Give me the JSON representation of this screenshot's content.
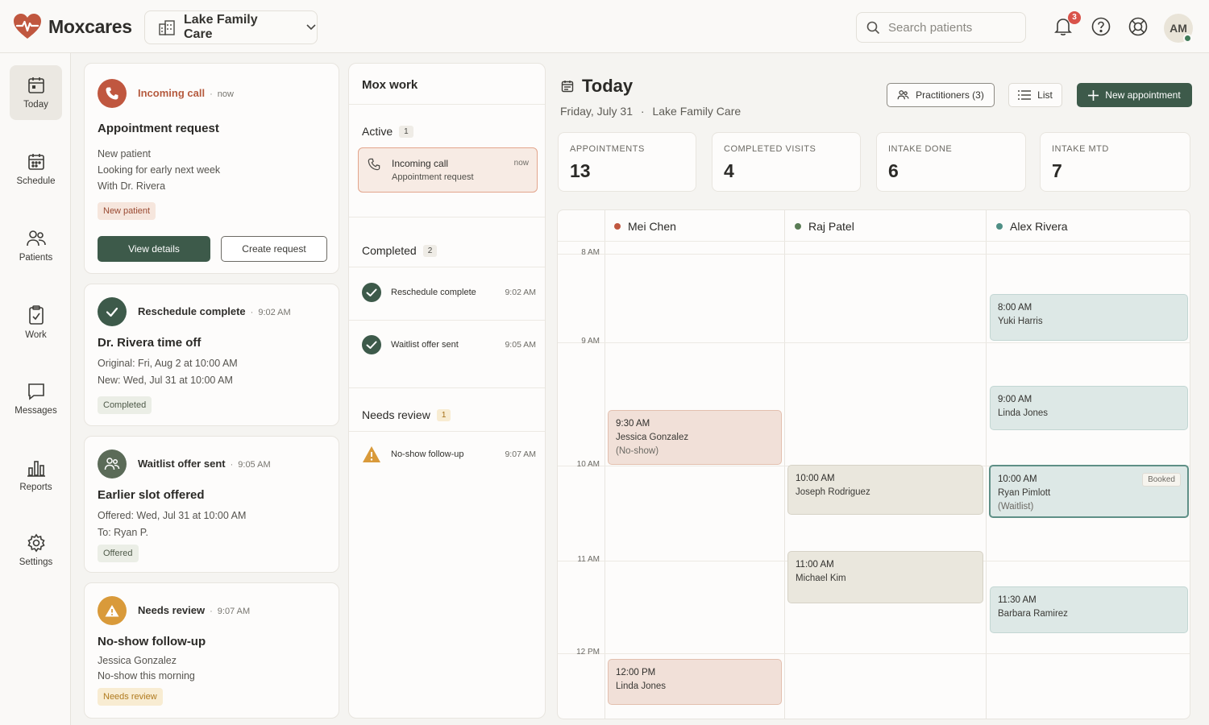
{
  "brand": {
    "name": "Moxcares",
    "color": "#c0573f"
  },
  "clinic": {
    "name": "Lake Family Care"
  },
  "search": {
    "placeholder": "Search patients"
  },
  "notifications": {
    "count": "3"
  },
  "user": {
    "initials": "AM",
    "status": "online"
  },
  "sidebar": {
    "items": [
      {
        "label": "Today",
        "icon": "calendar-today-icon",
        "active": true
      },
      {
        "label": "Schedule",
        "icon": "calendar-grid-icon"
      },
      {
        "label": "Patients",
        "icon": "users-icon"
      },
      {
        "label": "Work",
        "icon": "clipboard-check-icon"
      },
      {
        "label": "Messages",
        "icon": "message-icon"
      },
      {
        "label": "Reports",
        "icon": "bar-chart-icon"
      },
      {
        "label": "Settings",
        "icon": "gear-icon"
      }
    ]
  },
  "cards": {
    "incoming": {
      "head": "Incoming call",
      "time": "now",
      "title": "Appointment request",
      "lines": [
        "New patient",
        "Looking for early next week",
        "With Dr. Rivera"
      ],
      "pill": "New patient",
      "primary": "View details",
      "secondary": "Create request"
    },
    "reschedule": {
      "head": "Reschedule complete",
      "time": "9:02 AM",
      "title": "Dr. Rivera time off",
      "lines": [
        "Original: Fri, Aug 2 at 10:00 AM",
        "New: Wed, Jul 31 at 10:00 AM"
      ],
      "pill": "Completed"
    },
    "waitlist": {
      "head": "Waitlist offer sent",
      "time": "9:05 AM",
      "title": "Earlier slot offered",
      "lines": [
        "Offered: Wed, Jul 31 at 10:00 AM",
        "To: Ryan P."
      ],
      "pill": "Offered"
    },
    "review": {
      "head": "Needs review",
      "time": "9:07 AM",
      "title": "No-show follow-up",
      "lines": [
        "Jessica Gonzalez",
        "No-show this morning"
      ],
      "pill": "Needs review"
    }
  },
  "mox": {
    "title": "Mox work",
    "active": {
      "label": "Active",
      "count": "1",
      "item": {
        "title": "Incoming call",
        "subtitle": "Appointment request",
        "time": "now"
      }
    },
    "completed": {
      "label": "Completed",
      "count": "2",
      "items": [
        {
          "label": "Reschedule complete",
          "time": "9:02 AM"
        },
        {
          "label": "Waitlist offer sent",
          "time": "9:05 AM"
        }
      ]
    },
    "review": {
      "label": "Needs review",
      "count": "1",
      "items": [
        {
          "label": "No-show follow-up",
          "time": "9:07 AM"
        }
      ]
    }
  },
  "today": {
    "title": "Today",
    "date": "Friday, July 31",
    "location": "Lake Family Care",
    "practitioners_btn": "Practitioners (3)",
    "list_btn": "List",
    "new_btn": "New appointment"
  },
  "stats": [
    {
      "label": "APPOINTMENTS",
      "value": "13"
    },
    {
      "label": "COMPLETED VISITS",
      "value": "4"
    },
    {
      "label": "INTAKE DONE",
      "value": "6"
    },
    {
      "label": "INTAKE MTD",
      "value": "7"
    }
  ],
  "calendar": {
    "hours": [
      "8 AM",
      "9 AM",
      "10 AM",
      "11 AM",
      "12 PM"
    ],
    "practitioners": [
      {
        "name": "Mei Chen",
        "color": "#c0573f"
      },
      {
        "name": "Raj Patel",
        "color": "#5a7c55"
      },
      {
        "name": "Alex Rivera",
        "color": "#4f8f85"
      }
    ],
    "appointments": {
      "jessica": {
        "time": "9:30 AM",
        "name": "Jessica Gonzalez",
        "note": "(No-show)"
      },
      "linda_mei": {
        "time": "12:00 PM",
        "name": "Linda Jones"
      },
      "joseph": {
        "time": "10:00 AM",
        "name": "Joseph Rodriguez"
      },
      "michael": {
        "time": "11:00 AM",
        "name": "Michael Kim"
      },
      "yuki": {
        "time": "8:00 AM",
        "name": "Yuki Harris"
      },
      "linda_alex": {
        "time": "9:00 AM",
        "name": "Linda Jones"
      },
      "ryan": {
        "time": "10:00 AM",
        "name": "Ryan Pimlott",
        "note": "(Waitlist)",
        "badge": "Booked"
      },
      "barbara": {
        "time": "11:30 AM",
        "name": "Barbara Ramirez"
      }
    }
  }
}
